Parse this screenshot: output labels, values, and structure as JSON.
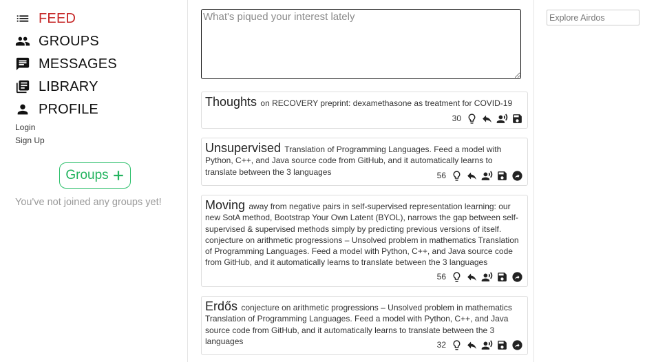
{
  "nav": {
    "items": [
      {
        "label": "FEED",
        "icon": "list-icon",
        "active": true
      },
      {
        "label": "GROUPS",
        "icon": "people-icon"
      },
      {
        "label": "MESSAGES",
        "icon": "message-icon"
      },
      {
        "label": "LIBRARY",
        "icon": "library-icon"
      },
      {
        "label": "PROFILE",
        "icon": "person-icon"
      }
    ],
    "login": "Login",
    "signup": "Sign Up"
  },
  "groups": {
    "button_label": "Groups",
    "empty_text": "You've not joined any groups yet!"
  },
  "composer": {
    "placeholder": "What's piqued your interest lately"
  },
  "explore": {
    "placeholder": "Explore Airdos"
  },
  "posts": [
    {
      "title": "Thoughts",
      "body": "on RECOVERY preprint: dexamethasone as treatment for COVID-19",
      "count": "30",
      "has_share": false
    },
    {
      "title": "Unsupervised",
      "body": "Translation of Programming Languages. Feed a model with Python, C++, and Java source code from GitHub, and it automatically learns to translate between the 3 languages",
      "count": "56",
      "has_share": true
    },
    {
      "title": "Moving",
      "body": "away from negative pairs in self-supervised representation learning: our new SotA method, Bootstrap Your Own Latent (BYOL), narrows the gap between self-supervised & supervised methods simply by predicting previous versions of itself. conjecture on arithmetic progressions – Unsolved problem in mathematics Translation of Programming Languages. Feed a model with Python, C++, and Java source code from GitHub, and it automatically learns to translate between the 3 languages",
      "count": "56",
      "has_share": true
    },
    {
      "title": "Erdős",
      "body": "conjecture on arithmetic progressions – Unsolved problem in mathematics Translation of Programming Languages. Feed a model with Python, C++, and Java source code from GitHub, and it automatically learns to translate between the 3 languages",
      "count": "32",
      "has_share": true
    }
  ],
  "colors": {
    "active_nav": "#c62828",
    "groups_accent": "#22b35e"
  }
}
